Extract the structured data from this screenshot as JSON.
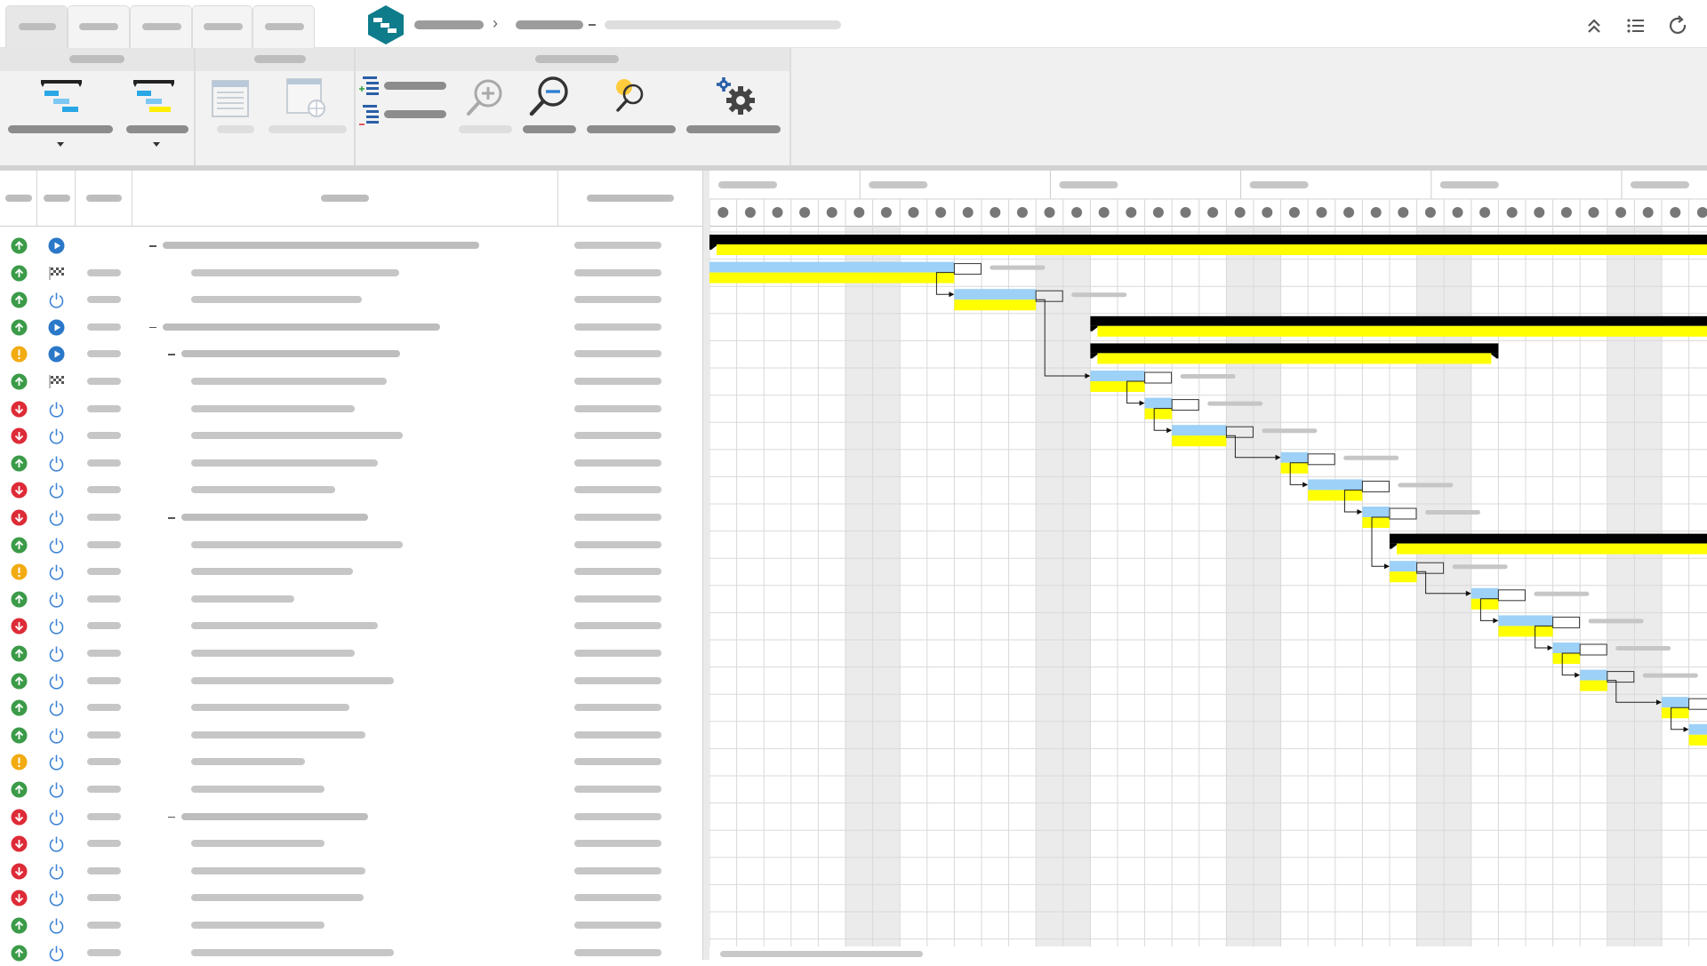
{
  "app": {
    "tabs": [
      "",
      "",
      "",
      "",
      ""
    ],
    "active_tab": 0,
    "breadcrumb": [
      "",
      "",
      ""
    ],
    "top_icons": [
      "collapse-up-icon",
      "list-icon",
      "refresh-icon"
    ]
  },
  "ribbon": {
    "groups": [
      {
        "name": "",
        "buttons": [
          {
            "icon": "gantt-layout-icon",
            "label": "",
            "dropdown": true
          },
          {
            "icon": "gantt-highlight-icon",
            "label": "",
            "dropdown": true
          }
        ]
      },
      {
        "name": "",
        "buttons": [
          {
            "icon": "page-view-icon",
            "label": "",
            "enabled": false
          },
          {
            "icon": "page-web-icon",
            "label": "",
            "enabled": false
          }
        ]
      },
      {
        "name": "",
        "buttons": [
          {
            "icon": "expand-all-icon",
            "label": ""
          },
          {
            "icon": "collapse-all-icon",
            "label": ""
          },
          {
            "icon": "zoom-in-icon",
            "label": "",
            "enabled": false
          },
          {
            "icon": "zoom-out-icon",
            "label": ""
          },
          {
            "icon": "zoom-fit-icon",
            "label": ""
          },
          {
            "icon": "settings-icon",
            "label": ""
          }
        ]
      }
    ]
  },
  "grid": {
    "columns": [
      "",
      "",
      "",
      "",
      ""
    ],
    "rows": [
      {
        "status": "up",
        "state": "play",
        "level": 0,
        "summary": true
      },
      {
        "status": "up",
        "state": "milestone",
        "level": 2,
        "summary": false
      },
      {
        "status": "up",
        "state": "power",
        "level": 2,
        "summary": false
      },
      {
        "status": "up",
        "state": "play",
        "level": 0,
        "summary": true
      },
      {
        "status": "warn",
        "state": "play",
        "level": 1,
        "summary": true
      },
      {
        "status": "up",
        "state": "milestone",
        "level": 2,
        "summary": false
      },
      {
        "status": "down",
        "state": "power",
        "level": 2,
        "summary": false
      },
      {
        "status": "down",
        "state": "power",
        "level": 2,
        "summary": false
      },
      {
        "status": "up",
        "state": "power",
        "level": 2,
        "summary": false
      },
      {
        "status": "down",
        "state": "power",
        "level": 2,
        "summary": false
      },
      {
        "status": "down",
        "state": "power",
        "level": 1,
        "summary": true
      },
      {
        "status": "up",
        "state": "power",
        "level": 2,
        "summary": false
      },
      {
        "status": "warn",
        "state": "power",
        "level": 2,
        "summary": false
      },
      {
        "status": "up",
        "state": "power",
        "level": 2,
        "summary": false
      },
      {
        "status": "down",
        "state": "power",
        "level": 2,
        "summary": false
      },
      {
        "status": "up",
        "state": "power",
        "level": 2,
        "summary": false
      },
      {
        "status": "up",
        "state": "power",
        "level": 2,
        "summary": false
      },
      {
        "status": "up",
        "state": "power",
        "level": 2,
        "summary": false
      },
      {
        "status": "up",
        "state": "power",
        "level": 2,
        "summary": false
      },
      {
        "status": "warn",
        "state": "power",
        "level": 2,
        "summary": false
      },
      {
        "status": "up",
        "state": "power",
        "level": 2,
        "summary": false
      },
      {
        "status": "down",
        "state": "power",
        "level": 1,
        "summary": true
      },
      {
        "status": "down",
        "state": "power",
        "level": 2,
        "summary": false
      },
      {
        "status": "down",
        "state": "power",
        "level": 2,
        "summary": false
      },
      {
        "status": "down",
        "state": "power",
        "level": 2,
        "summary": false
      },
      {
        "status": "up",
        "state": "power",
        "level": 2,
        "summary": false
      },
      {
        "status": "up",
        "state": "power",
        "level": 2,
        "summary": false
      }
    ]
  },
  "gantt": {
    "colors": {
      "summary": "#000000",
      "baseline": "#ffff00",
      "task": "#9dd1f7",
      "weekend": "#ebebeb",
      "grid": "#d9d9d9",
      "day_dot": "#777777"
    },
    "timescale_days": 37,
    "tasks": [
      {
        "type": "summary",
        "start": 0,
        "end": 37
      },
      {
        "type": "task",
        "start": 0,
        "end": 9,
        "progress": 0.0
      },
      {
        "type": "task",
        "start": 9,
        "end": 12,
        "progress": 0.0
      },
      {
        "type": "summary",
        "start": 14,
        "end": 37
      },
      {
        "type": "summary",
        "start": 14,
        "end": 29
      },
      {
        "type": "task",
        "start": 14,
        "end": 16
      },
      {
        "type": "task",
        "start": 16,
        "end": 17
      },
      {
        "type": "task",
        "start": 17,
        "end": 19
      },
      {
        "type": "task",
        "start": 21,
        "end": 22
      },
      {
        "type": "task",
        "start": 22,
        "end": 24
      },
      {
        "type": "task",
        "start": 24,
        "end": 25
      },
      {
        "type": "summary",
        "start": 25,
        "end": 37
      },
      {
        "type": "task",
        "start": 25,
        "end": 26
      },
      {
        "type": "task",
        "start": 28,
        "end": 29
      },
      {
        "type": "task",
        "start": 29,
        "end": 31
      },
      {
        "type": "task",
        "start": 31,
        "end": 32
      },
      {
        "type": "task",
        "start": 32,
        "end": 33
      },
      {
        "type": "task",
        "start": 35,
        "end": 36
      },
      {
        "type": "task",
        "start": 36,
        "end": 37
      }
    ]
  }
}
